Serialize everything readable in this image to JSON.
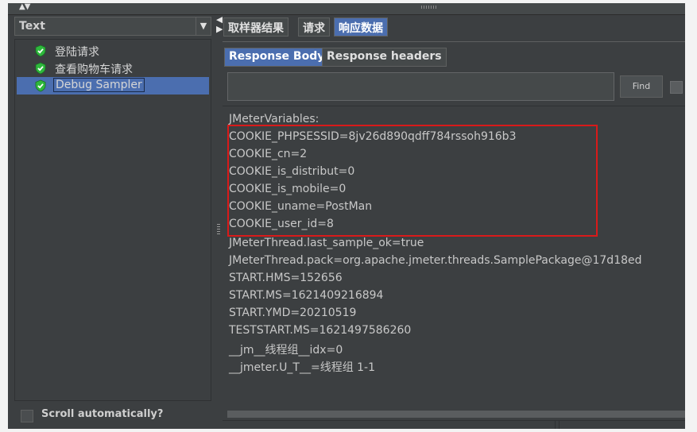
{
  "left_panel": {
    "combo_value": "Text",
    "tree_items": [
      {
        "label": "登陆请求",
        "selected": false
      },
      {
        "label": "查看购物车请求",
        "selected": false
      },
      {
        "label": "Debug Sampler",
        "selected": true
      }
    ],
    "scroll_auto_label": "Scroll automatically?"
  },
  "tabs": {
    "primary": [
      "取样器结果",
      "请求",
      "响应数据"
    ],
    "primary_active": "响应数据",
    "secondary": [
      "Response Body",
      "Response headers"
    ],
    "secondary_active": "Response Body"
  },
  "search": {
    "value": "",
    "find_label": "Find"
  },
  "response_lines": [
    "JMeterVariables:",
    "COOKIE_PHPSESSID=8jv26d890qdff784rssoh916b3",
    "COOKIE_cn=2",
    "COOKIE_is_distribut=0",
    "COOKIE_is_mobile=0",
    "COOKIE_uname=PostMan",
    "COOKIE_user_id=8",
    "JMeterThread.last_sample_ok=true",
    "JMeterThread.pack=org.apache.jmeter.threads.SamplePackage@17d18ed",
    "START.HMS=152656",
    "START.MS=1621409216894",
    "START.YMD=20210519",
    "TESTSTART.MS=1621497586260",
    "__jm__线程组__idx=0",
    "__jmeter.U_T__=线程组 1-1"
  ],
  "colors": {
    "background": "#3c3f41",
    "selection": "#4b6eaf",
    "highlight_box": "#d91a1a",
    "check_icon": "#3bd14b"
  }
}
